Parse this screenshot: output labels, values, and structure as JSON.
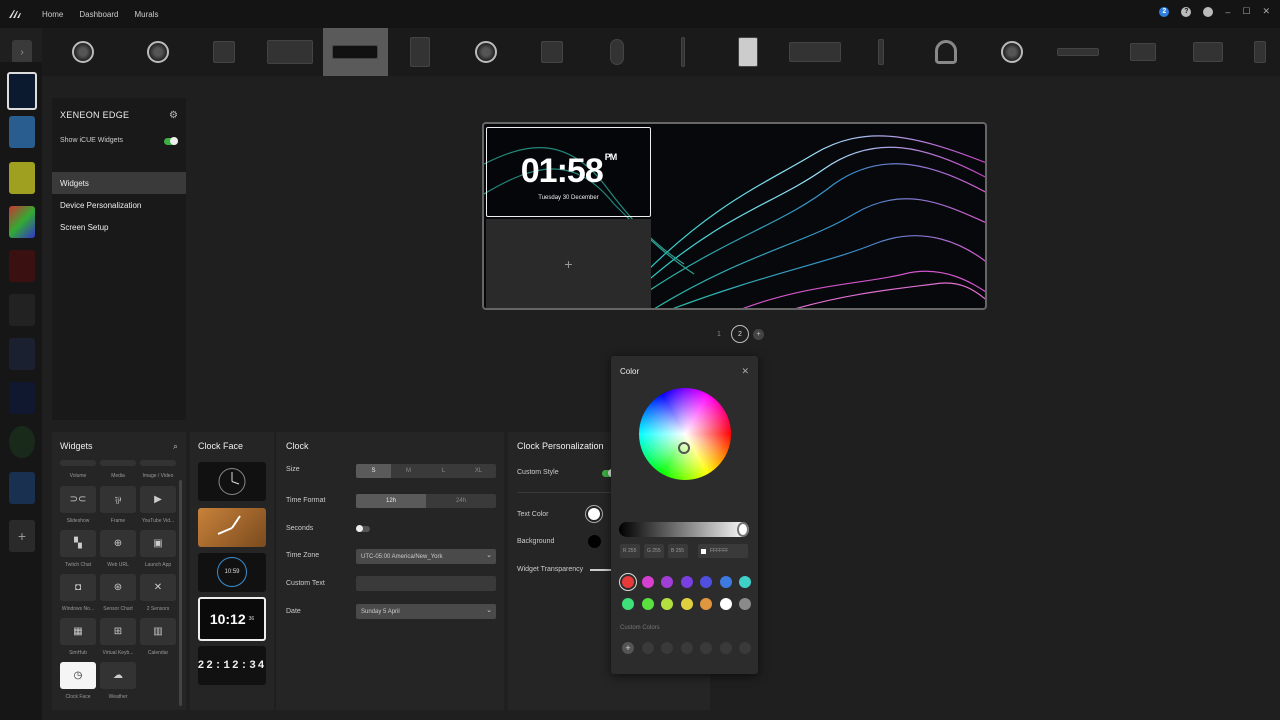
{
  "topbar": {
    "nav": [
      "Home",
      "Dashboard",
      "Murals"
    ],
    "badge": "2",
    "help": "?",
    "win_min": "–",
    "win_max": "☐",
    "win_close": "✕"
  },
  "device_bar": {
    "expand": "›"
  },
  "left_panel": {
    "title": "XENEON EDGE",
    "show_widgets_label": "Show iCUE Widgets",
    "show_widgets_on": true,
    "menu": [
      "Widgets",
      "Device Personalization",
      "Screen Setup"
    ]
  },
  "preview": {
    "time": "01:58",
    "ampm": "PM",
    "date": "Tuesday 30 December",
    "add": "+"
  },
  "pagination": {
    "pages": [
      "1",
      "2"
    ],
    "current": "2",
    "add": "+"
  },
  "widgets_panel": {
    "title": "Widgets",
    "items": [
      {
        "label": "Volume",
        "icon": "volume-icon",
        "glyph": ""
      },
      {
        "label": "Media",
        "icon": "media-icon",
        "glyph": ""
      },
      {
        "label": "Image / Video",
        "icon": "image-icon",
        "glyph": ""
      },
      {
        "label": "Slideshow",
        "icon": "slideshow-icon",
        "glyph": "⊃⊂"
      },
      {
        "label": "Frame",
        "icon": "frame-icon",
        "glyph": "⅌"
      },
      {
        "label": "YouTube Vid...",
        "icon": "youtube-icon",
        "glyph": "▶"
      },
      {
        "label": "Twitch Chat",
        "icon": "twitch-icon",
        "glyph": "▚"
      },
      {
        "label": "Web URL",
        "icon": "globe-icon",
        "glyph": "⊕"
      },
      {
        "label": "Launch App",
        "icon": "launch-icon",
        "glyph": "▣"
      },
      {
        "label": "Windows No...",
        "icon": "notification-icon",
        "glyph": "◘"
      },
      {
        "label": "Sensor Chart",
        "icon": "sensor-icon",
        "glyph": "⊛"
      },
      {
        "label": "2 Sensors",
        "icon": "sensors-icon",
        "glyph": "✕"
      },
      {
        "label": "SimHub",
        "icon": "simhub-icon",
        "glyph": "▦"
      },
      {
        "label": "Virtual Keyb...",
        "icon": "keyboard-icon",
        "glyph": "⊞"
      },
      {
        "label": "Calendar",
        "icon": "calendar-icon",
        "glyph": "▥"
      },
      {
        "label": "Clock Face",
        "icon": "clock-icon",
        "glyph": "◷"
      },
      {
        "label": "Weather",
        "icon": "weather-icon",
        "glyph": "☁"
      }
    ],
    "selected": "Clock Face"
  },
  "clockface_panel": {
    "title": "Clock Face",
    "faces": [
      {
        "name": "analog-dark",
        "text": ""
      },
      {
        "name": "analog-orange",
        "text": ""
      },
      {
        "name": "digital-round",
        "text": "10:59"
      },
      {
        "name": "digital-large",
        "text": "10:12",
        "sub": "36"
      },
      {
        "name": "flip",
        "text": "22:12:34"
      }
    ]
  },
  "clock_panel": {
    "title": "Clock",
    "size_label": "Size",
    "size_options": [
      "S",
      "M",
      "L",
      "XL"
    ],
    "size_selected": "S",
    "time_format_label": "Time Format",
    "time_format_options": [
      "12h",
      "24h"
    ],
    "time_format_selected": "12h",
    "seconds_label": "Seconds",
    "timezone_label": "Time Zone",
    "timezone_value": "UTC-05:00 America/New_York",
    "custom_text_label": "Custom Text",
    "custom_text_value": "",
    "date_label": "Date",
    "date_value": "Sunday 5 April"
  },
  "personalization_panel": {
    "title": "Clock Personalization",
    "custom_style_label": "Custom Style",
    "text_color_label": "Text Color",
    "background_label": "Background",
    "transparency_label": "Widget Transparency"
  },
  "color_popup": {
    "title": "Color",
    "close": "✕",
    "r_label": "R",
    "r": "255",
    "g_label": "G",
    "g": "255",
    "b_label": "B",
    "b": "255",
    "hex": "FFFFFF",
    "presets": [
      "#e83a3a",
      "#d63fd0",
      "#a03fd6",
      "#7a3fe0",
      "#4f4fe0",
      "#3f7ae0",
      "#3fd0c8",
      "#3fe07a",
      "#5ae03f",
      "#b4e03f",
      "#e0d03f",
      "#e0953f",
      "#ffffff",
      "#8a8a8a"
    ],
    "custom_colors_label": "Custom Colors",
    "add": "+"
  }
}
